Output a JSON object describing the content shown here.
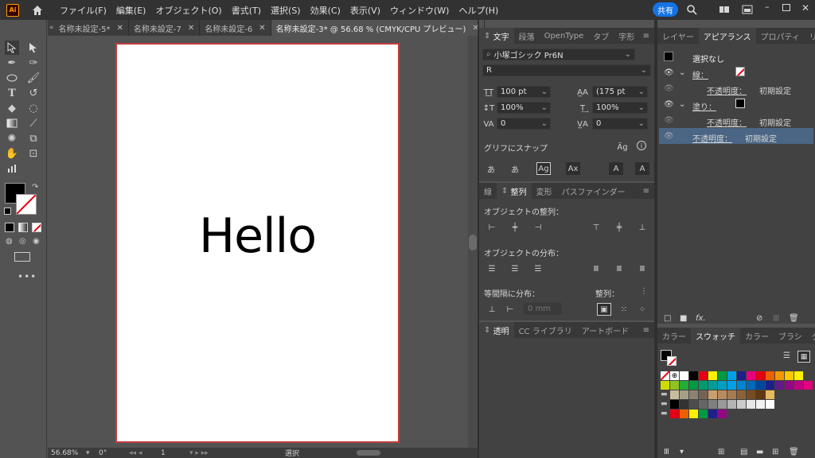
{
  "app": {
    "logo": "Ai",
    "share": "共有"
  },
  "menu": [
    "ファイル(F)",
    "編集(E)",
    "オブジェクト(O)",
    "書式(T)",
    "選択(S)",
    "効果(C)",
    "表示(V)",
    "ウィンドウ(W)",
    "ヘルプ(H)"
  ],
  "tabs": [
    {
      "label": "名称未設定-5*"
    },
    {
      "label": "名称未設定-7"
    },
    {
      "label": "名称未設定-6"
    },
    {
      "label": "名称未設定-3* @ 56.68 % (CMYK/CPU プレビュー)"
    }
  ],
  "canvas": {
    "text": "Hello"
  },
  "status": {
    "zoom": "56.68%",
    "angle": "0°",
    "page": "1",
    "mode": "選択"
  },
  "type_panel": {
    "tabs": [
      "文字",
      "段落",
      "OpenType",
      "タブ",
      "字形"
    ],
    "font_family": "小塚ゴシック Pr6N",
    "font_style": "R",
    "font_size": "100 pt",
    "leading": "(175 pt",
    "vscale": "100%",
    "hscale": "100%",
    "kerning": "0",
    "tracking": "0",
    "snap_label": "グリフにスナップ"
  },
  "align_panel": {
    "tabs": [
      "線",
      "整列",
      "変形",
      "パスファインダー"
    ],
    "align_objects": "オブジェクトの整列：",
    "distribute_objects": "オブジェクトの分布：",
    "distribute_spacing": "等間隔に分布：",
    "align_to": "整列：",
    "spacing_value": "0 mm"
  },
  "bottom_panel": {
    "tabs": [
      "透明",
      "CC ライブラリ",
      "アートボード"
    ]
  },
  "appearance_panel": {
    "tabs": [
      "レイヤー",
      "アピアランス",
      "プロパティ",
      "リンク"
    ],
    "title": "選択なし",
    "stroke_label": "線：",
    "fill_label": "塗り：",
    "opacity_label": "不透明度：",
    "opacity_value": "初期設定"
  },
  "swatches_panel": {
    "tabs": [
      "カラー",
      "スウォッチ",
      "カラー",
      "ブラシ",
      "グラデ"
    ],
    "row1": [
      "#ffffff",
      "#000000",
      "#e60012",
      "#fff100",
      "#009944",
      "#00a0e9",
      "#1d2088",
      "#e4007f",
      "#e60012",
      "#eb6100",
      "#f39800",
      "#fcc800",
      "#fff100"
    ],
    "row2": [
      "#cfdb00",
      "#8fc31f",
      "#22ac38",
      "#009944",
      "#009b6b",
      "#009e96",
      "#00a0c1",
      "#00a0e9",
      "#0086d1",
      "#0068b7",
      "#00479d",
      "#1d2088",
      "#601986",
      "#920783",
      "#be0081",
      "#e4007f"
    ],
    "row3": [
      "#c9bc9c",
      "#a69f88",
      "#8e8372",
      "#736357",
      "#c7a06d",
      "#b98c5f",
      "#a67b52",
      "#8c6239",
      "#754c24",
      "#603813",
      "#e5b95d"
    ],
    "row4": [
      "#000000",
      "#333333",
      "#4d4d4d",
      "#666666",
      "#808080",
      "#999999",
      "#b3b3b3",
      "#cccccc",
      "#e6e6e6",
      "#f2f2f2",
      "#ffffff"
    ],
    "row5": [
      "#e60012",
      "#eb6100",
      "#fff100",
      "#009944",
      "#1d2088",
      "#920783"
    ]
  }
}
